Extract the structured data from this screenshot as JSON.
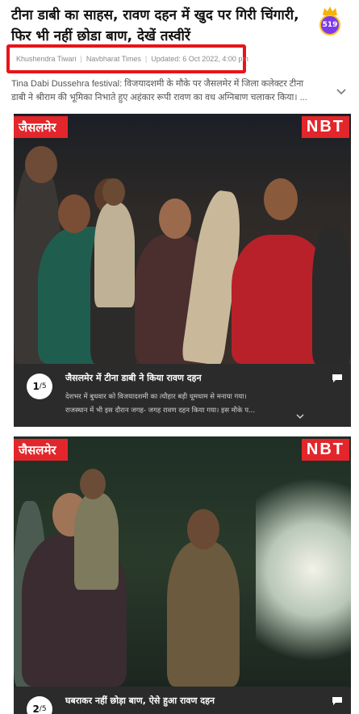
{
  "article": {
    "title_line1": "टीना डाबी का साहस, रावण दहन में खुद पर गिरी चिंगारी,",
    "title_line2": "फिर भी नहीं छोडा बाण, देखें तस्वीरें",
    "author": "Khushendra Tiwari",
    "source": "Navbharat Times",
    "updated": "Updated: 6 Oct 2022, 4:00 pm",
    "summary_line1": "Tina Dabi Dussehra festival: विजयादशमी के मौके पर जैसलमेर में जिला कलेक्टर टीना",
    "summary_line2": "डाबी ने श्रीराम की भूमिका निभाते हुए अहंकार रूपी रावण का वध अग्निबाण चलाकर किया। ...",
    "badge_count": "519"
  },
  "icons": {
    "badge": "crown-badge-icon",
    "expand": "chevron-down-icon",
    "comment": "comment-icon"
  },
  "colors": {
    "accent_red": "#e3262b",
    "highlight_red": "#e8141b",
    "caption_bg": "#2b2b2b",
    "badge_purple": "#7c3aed"
  },
  "slides": [
    {
      "place": "जैसलमेर",
      "watermark": "NBT",
      "index": "1",
      "total": "/5",
      "caption_title": "जैसलमेर में टीना डाबी ने किया रावण दहन",
      "caption_line1": "देशभर में बुधवार को विजयादशमी का त्यौहार बड़ी धूमधाम से मनाया गया।",
      "caption_line2": "राजस्थान में भी इस दौरान जगह- जगह रावण दहन किया गया। इस मौके प..."
    },
    {
      "place": "जैसलमेर",
      "watermark": "NBT",
      "index": "2",
      "total": "/5",
      "caption_title": "घबराकर नहीं छोड़ा बाण, ऐसे हुआ रावण दहन"
    }
  ]
}
